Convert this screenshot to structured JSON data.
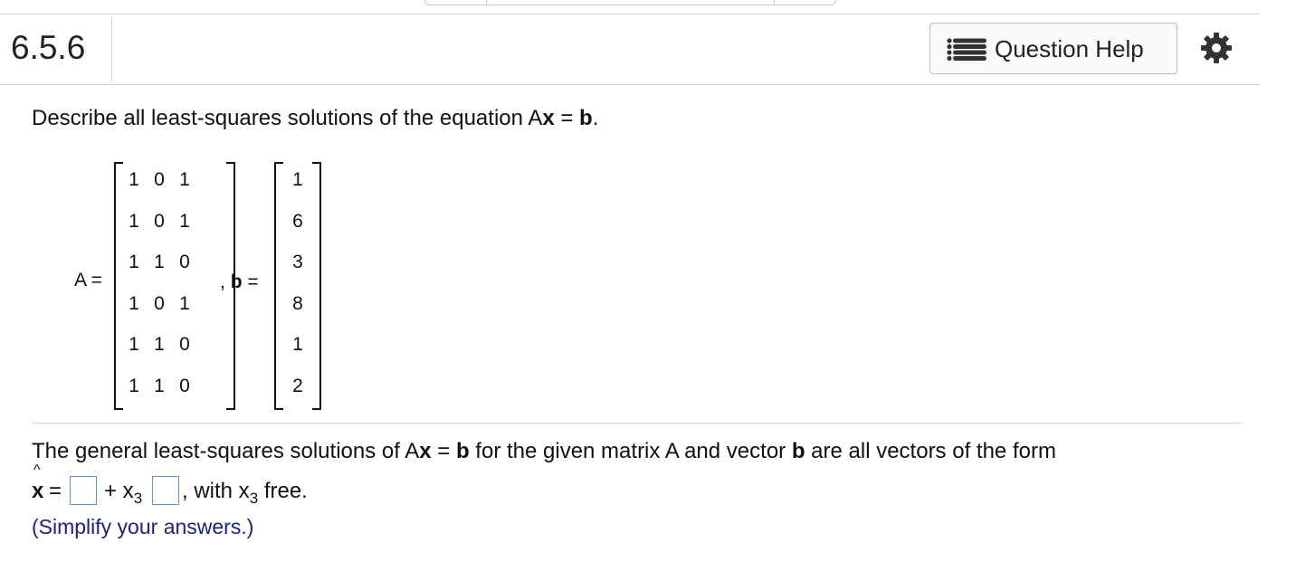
{
  "header": {
    "question_number": "6.5.6",
    "help_label": "Question Help"
  },
  "prompt": {
    "prefix": "Describe all least-squares solutions of the equation A",
    "x_bold": "x",
    "eq": " = ",
    "b_bold": "b",
    "suffix": "."
  },
  "matrix_A": {
    "label": "A =",
    "rows": [
      [
        "1",
        "0",
        "1"
      ],
      [
        "1",
        "0",
        "1"
      ],
      [
        "1",
        "1",
        "0"
      ],
      [
        "1",
        "0",
        "1"
      ],
      [
        "1",
        "1",
        "0"
      ],
      [
        "1",
        "1",
        "0"
      ]
    ]
  },
  "vector_b": {
    "label_sep": ",",
    "label_b": "b",
    "label_eq": "=",
    "values": [
      "1",
      "6",
      "3",
      "8",
      "1",
      "2"
    ]
  },
  "statement": {
    "t1": "The general least-squares solutions of A",
    "x": "x",
    "t2": " = ",
    "b": "b",
    "t3": " for the given matrix A and vector ",
    "b2": "b",
    "t4": " are all vectors of the form"
  },
  "answer": {
    "xhat": "x",
    "hat": "^",
    "eq": "=",
    "plus": "+ x",
    "sub3": "3",
    "with": ", with x",
    "sub3b": "3",
    "free": " free.",
    "box1_value": "",
    "box2_value": ""
  },
  "hint": "(Simplify your answers.)"
}
